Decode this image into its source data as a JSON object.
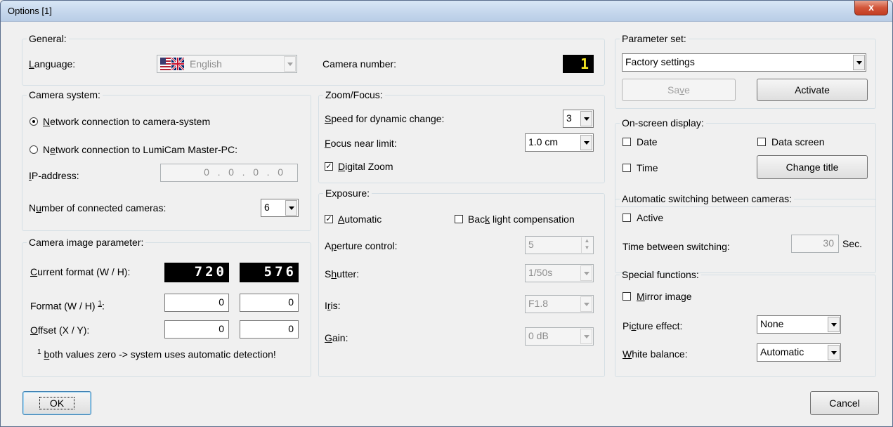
{
  "window": {
    "title": "Options [1]",
    "close_glyph": "x"
  },
  "general": {
    "legend": "General:",
    "language_label_u": "L",
    "language_label_rest": "anguage:",
    "language_value": "English",
    "camera_number_label": "Camera number:",
    "camera_number_value": "1"
  },
  "parameter_set": {
    "legend": "Parameter set:",
    "selected": "Factory settings",
    "save_label_pre": "Sa",
    "save_label_u": "v",
    "save_label_post": "e",
    "activate_label": "Activate"
  },
  "camera_system": {
    "legend": "Camera system:",
    "opt1_u": "N",
    "opt1_rest": "etwork connection to camera-system",
    "opt2_pre": "N",
    "opt2_u": "e",
    "opt2_rest": "twork connection to LumiCam Master-PC:",
    "ip_label_u": "I",
    "ip_label_rest": "P-address:",
    "ip_value": "0   .   0   .   0   .   0",
    "num_cameras_label_pre": "N",
    "num_cameras_label_u": "u",
    "num_cameras_label_rest": "mber of connected cameras:",
    "num_cameras_value": "6"
  },
  "zoom_focus": {
    "legend": "Zoom/Focus:",
    "speed_label_u": "S",
    "speed_label_rest": "peed for dynamic change:",
    "speed_value": "3",
    "focus_label_u": "F",
    "focus_label_rest": "ocus near limit:",
    "focus_value": "1.0 cm",
    "digital_zoom_u": "D",
    "digital_zoom_rest": "igital Zoom",
    "digital_zoom_checked": true
  },
  "osd": {
    "legend": "On-screen display:",
    "date_label": "Date",
    "data_screen_label": "Data screen",
    "time_label": "Time",
    "change_title_label": "Change title"
  },
  "exposure": {
    "legend": "Exposure:",
    "automatic_u": "A",
    "automatic_rest": "utomatic",
    "automatic_checked": true,
    "backlight_pre": "Bac",
    "backlight_u": "k",
    "backlight_rest": " light compensation",
    "aperture_label_pre": "A",
    "aperture_label_u": "p",
    "aperture_label_rest": "erture control:",
    "aperture_value": "5",
    "shutter_label_pre": "S",
    "shutter_label_u": "h",
    "shutter_label_rest": "utter:",
    "shutter_value": "1/50s",
    "iris_label_pre": "I",
    "iris_label_u": "r",
    "iris_label_rest": "is:",
    "iris_value": "F1.8",
    "gain_label_u": "G",
    "gain_label_rest": "ain:",
    "gain_value": "0 dB"
  },
  "auto_switch": {
    "legend": "Automatic switching between cameras:",
    "active_label": "Active",
    "time_label": "Time between switching:",
    "time_value": "30",
    "time_unit": "Sec."
  },
  "image_param": {
    "legend": "Camera image parameter:",
    "current_format_u": "C",
    "current_format_rest": "urrent format (W / H):",
    "current_w": "720",
    "current_h": "576",
    "format_label": "Format (W / H) ",
    "format_sup_u": "1",
    "format_colon": ":",
    "format_w": "0",
    "format_h": "0",
    "offset_u": "O",
    "offset_rest": "ffset (X / Y):",
    "offset_x": "0",
    "offset_y": "0",
    "footnote_sup": "1",
    "footnote_u": "b",
    "footnote_rest": "oth values zero -> system uses automatic detection!"
  },
  "special": {
    "legend": "Special functions:",
    "mirror_u": "M",
    "mirror_rest": "irror image",
    "picture_effect_pre": "Pi",
    "picture_effect_u": "c",
    "picture_effect_rest": "ture effect:",
    "picture_effect_value": "None",
    "white_balance_u": "W",
    "white_balance_rest": "hite balance:",
    "white_balance_value": "Automatic"
  },
  "footer": {
    "ok_label": "OK",
    "cancel_label": "Cancel"
  }
}
